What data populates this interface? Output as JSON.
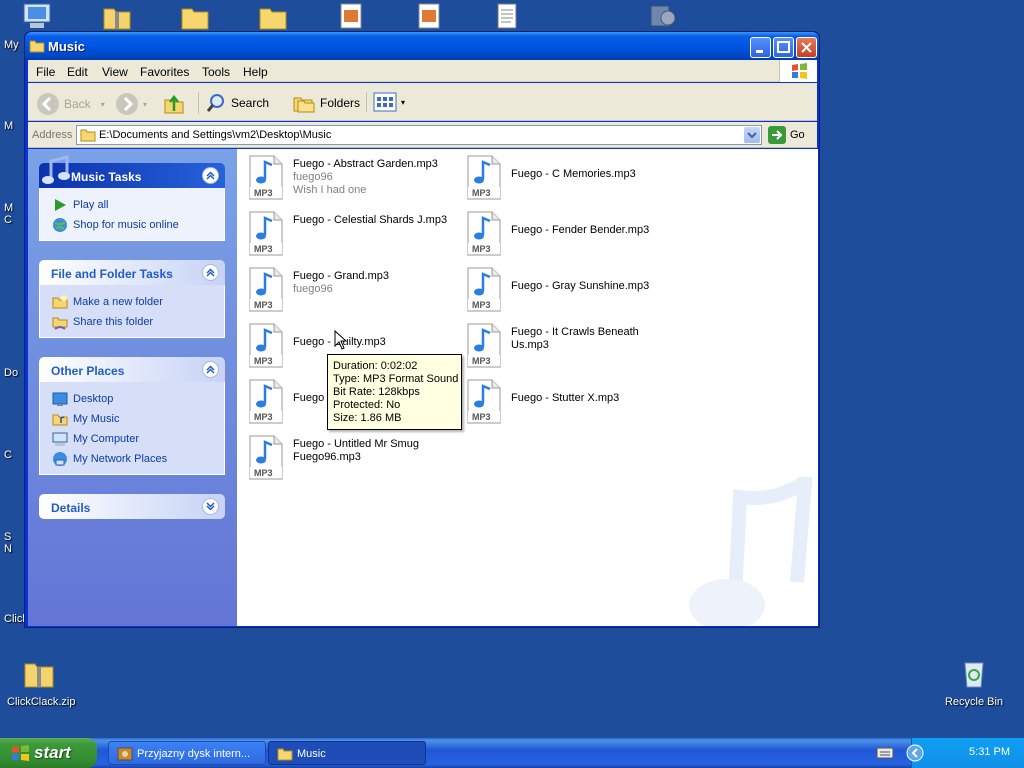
{
  "desktop": {
    "icons": [
      {
        "label": "ClickClack.zip",
        "icon": "zip-folder-icon"
      },
      {
        "label": "Recycle Bin",
        "icon": "recycle-bin-icon"
      }
    ],
    "fragments": [
      "My",
      "M",
      "M",
      "C",
      "Do",
      "C",
      "S",
      "N",
      "Click"
    ]
  },
  "window": {
    "title": "Music",
    "menu": [
      "File",
      "Edit",
      "View",
      "Favorites",
      "Tools",
      "Help"
    ],
    "toolbar": {
      "back": "Back",
      "search": "Search",
      "folders": "Folders"
    },
    "address": {
      "label": "Address",
      "value": "E:\\Documents and Settings\\vm2\\Desktop\\Music",
      "go": "Go"
    }
  },
  "tasks": {
    "music": {
      "title": "Music Tasks",
      "items": [
        "Play all",
        "Shop for music online"
      ]
    },
    "file_folder": {
      "title": "File and Folder Tasks",
      "items": [
        "Make a new folder",
        "Share this folder"
      ]
    },
    "other_places": {
      "title": "Other Places",
      "items": [
        "Desktop",
        "My Music",
        "My Computer",
        "My Network Places"
      ]
    },
    "details": {
      "title": "Details"
    }
  },
  "files": [
    {
      "name": "Fuego - Abstract Garden.mp3",
      "artist": "fuego96",
      "album": "Wish I had one"
    },
    {
      "name": "Fuego - C Memories.mp3"
    },
    {
      "name": "Fuego - Celestial Shards J.mp3"
    },
    {
      "name": "Fuego - Fender Bender.mp3"
    },
    {
      "name": "Fuego - Grand.mp3",
      "artist": "fuego96"
    },
    {
      "name": "Fuego - Gray Sunshine.mp3"
    },
    {
      "name": "Fuego - Guilty.mp3"
    },
    {
      "name": "Fuego - It Crawls Beneath Us.mp3"
    },
    {
      "name": "Fuego"
    },
    {
      "name": "Fuego - Stutter X.mp3"
    },
    {
      "name": "Fuego - Untitled Mr Smug Fuego96.mp3"
    }
  ],
  "tooltip": {
    "duration": "Duration: 0:02:02",
    "type": "Type: MP3 Format Sound",
    "bitrate": "Bit Rate: 128kbps",
    "protected": "Protected: No",
    "size": "Size: 1.86 MB"
  },
  "taskbar": {
    "start": "start",
    "tasks": [
      "Przyjazny dysk intern...",
      "Music"
    ],
    "clock": "5:31 PM"
  },
  "colors": {
    "desktop": "#1e4d9c",
    "titlebar": "#0054e3",
    "taskpane": "#7ba2e7",
    "start": "#3c9a3b"
  }
}
